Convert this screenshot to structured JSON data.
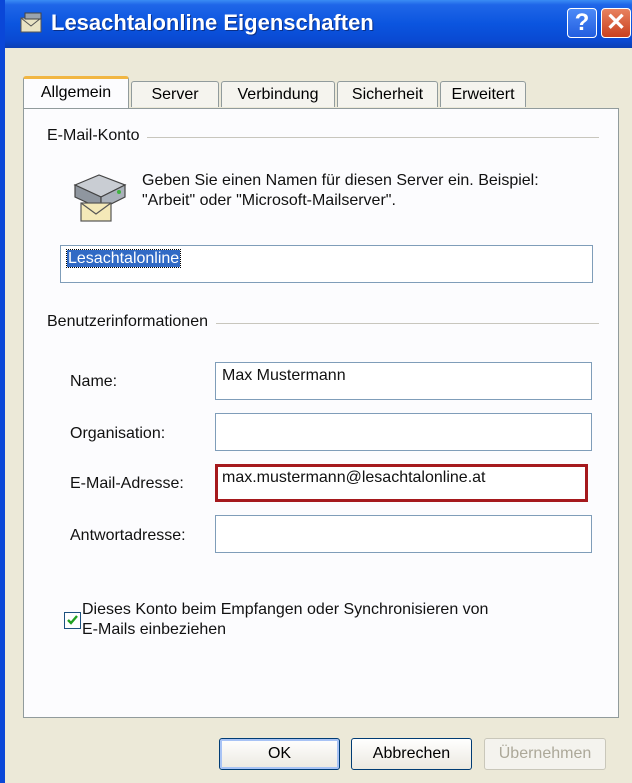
{
  "window": {
    "title": "Lesachtalonline Eigenschaften",
    "help_glyph": "?",
    "close_glyph": "✕"
  },
  "tabs": [
    {
      "label": "Allgemein",
      "active": true
    },
    {
      "label": "Server",
      "active": false
    },
    {
      "label": "Verbindung",
      "active": false
    },
    {
      "label": "Sicherheit",
      "active": false
    },
    {
      "label": "Erweitert",
      "active": false
    }
  ],
  "email_account": {
    "group_label": "E-Mail-Konto",
    "description_line1": "Geben Sie einen Namen für diesen Server ein. Beispiel:",
    "description_line2": "\"Arbeit\" oder \"Microsoft-Mailserver\".",
    "account_name_value": "Lesachtalonline"
  },
  "user_info": {
    "group_label": "Benutzerinformationen",
    "name_label": "Name:",
    "name_value": "Max Mustermann",
    "organization_label": "Organisation:",
    "organization_value": "",
    "email_label": "E-Mail-Adresse:",
    "email_value": "max.mustermann@lesachtalonline.at",
    "reply_label": "Antwortadresse:",
    "reply_value": ""
  },
  "include_account": {
    "checked": true,
    "label_line1": "Dieses Konto beim Empfangen oder Synchronisieren von",
    "label_line2": "E-Mails einbeziehen"
  },
  "buttons": {
    "ok": "OK",
    "cancel": "Abbrechen",
    "apply": "Übernehmen"
  },
  "colors": {
    "title_bar": "#0b55df",
    "highlight_border": "#a5191d",
    "selection": "#316ac5",
    "active_tab_accent": "#f1b643"
  }
}
